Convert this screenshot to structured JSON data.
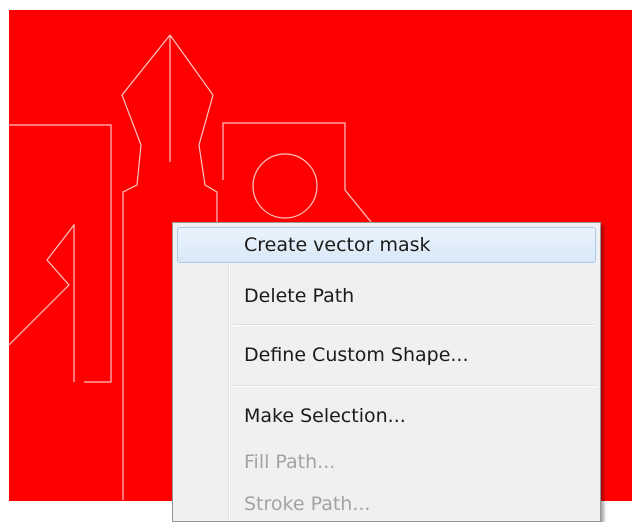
{
  "canvas": {
    "background_color": "#ff0000",
    "outline_color": "#ffc4c4"
  },
  "context_menu": {
    "items": [
      {
        "label": "Create vector mask",
        "state": "highlighted"
      },
      {
        "label": "Delete Path",
        "state": "enabled"
      },
      {
        "label": "Define Custom Shape...",
        "state": "enabled"
      },
      {
        "label": "Make Selection...",
        "state": "enabled"
      },
      {
        "label": "Fill Path...",
        "state": "disabled"
      },
      {
        "label": "Stroke Path...",
        "state": "disabled"
      }
    ]
  }
}
